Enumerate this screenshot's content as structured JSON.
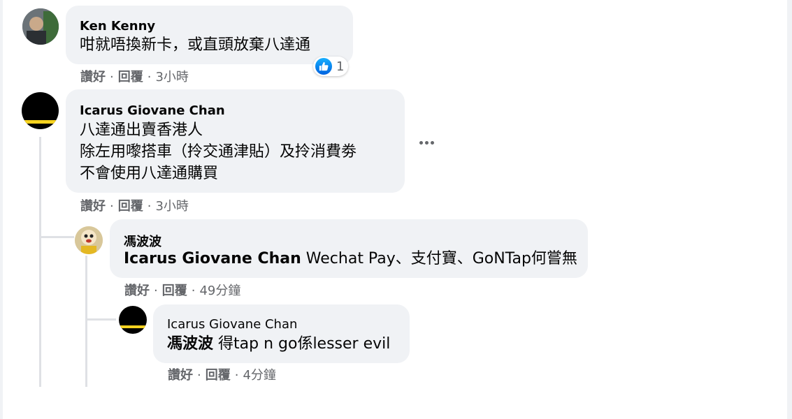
{
  "comments": [
    {
      "author": "Ken Kenny",
      "lines": [
        "咁就唔換新卡，或直頭放棄八達通"
      ],
      "reaction_count": "1",
      "actions": {
        "like": "讚好",
        "reply": "回覆",
        "time": "3小時"
      }
    },
    {
      "author": "Icarus Giovane Chan",
      "lines": [
        "八達通出賣香港人",
        "除左用嚟搭車（拎交通津貼）及拎消費劵",
        "不會使用八達通購買"
      ],
      "actions": {
        "like": "讚好",
        "reply": "回覆",
        "time": "3小時"
      }
    }
  ],
  "replies": [
    {
      "author": "馮波波",
      "mention": "Icarus Giovane Chan",
      "text": "Wechat Pay、支付寶、GoNTap何嘗無",
      "actions": {
        "like": "讚好",
        "reply": "回覆",
        "time": "49分鐘"
      }
    },
    {
      "author": "Icarus Giovane Chan",
      "mention": "馮波波",
      "text": "得tap n go係lesser evil",
      "actions": {
        "like": "讚好",
        "reply": "回覆",
        "time": "4分鐘"
      }
    }
  ],
  "separator": "·",
  "colors": {
    "bubble": "#f0f2f5",
    "meta": "#65676b",
    "like": "#0866ff"
  },
  "icons": {
    "like": "thumbs-up-icon",
    "more": "more-options-icon"
  }
}
